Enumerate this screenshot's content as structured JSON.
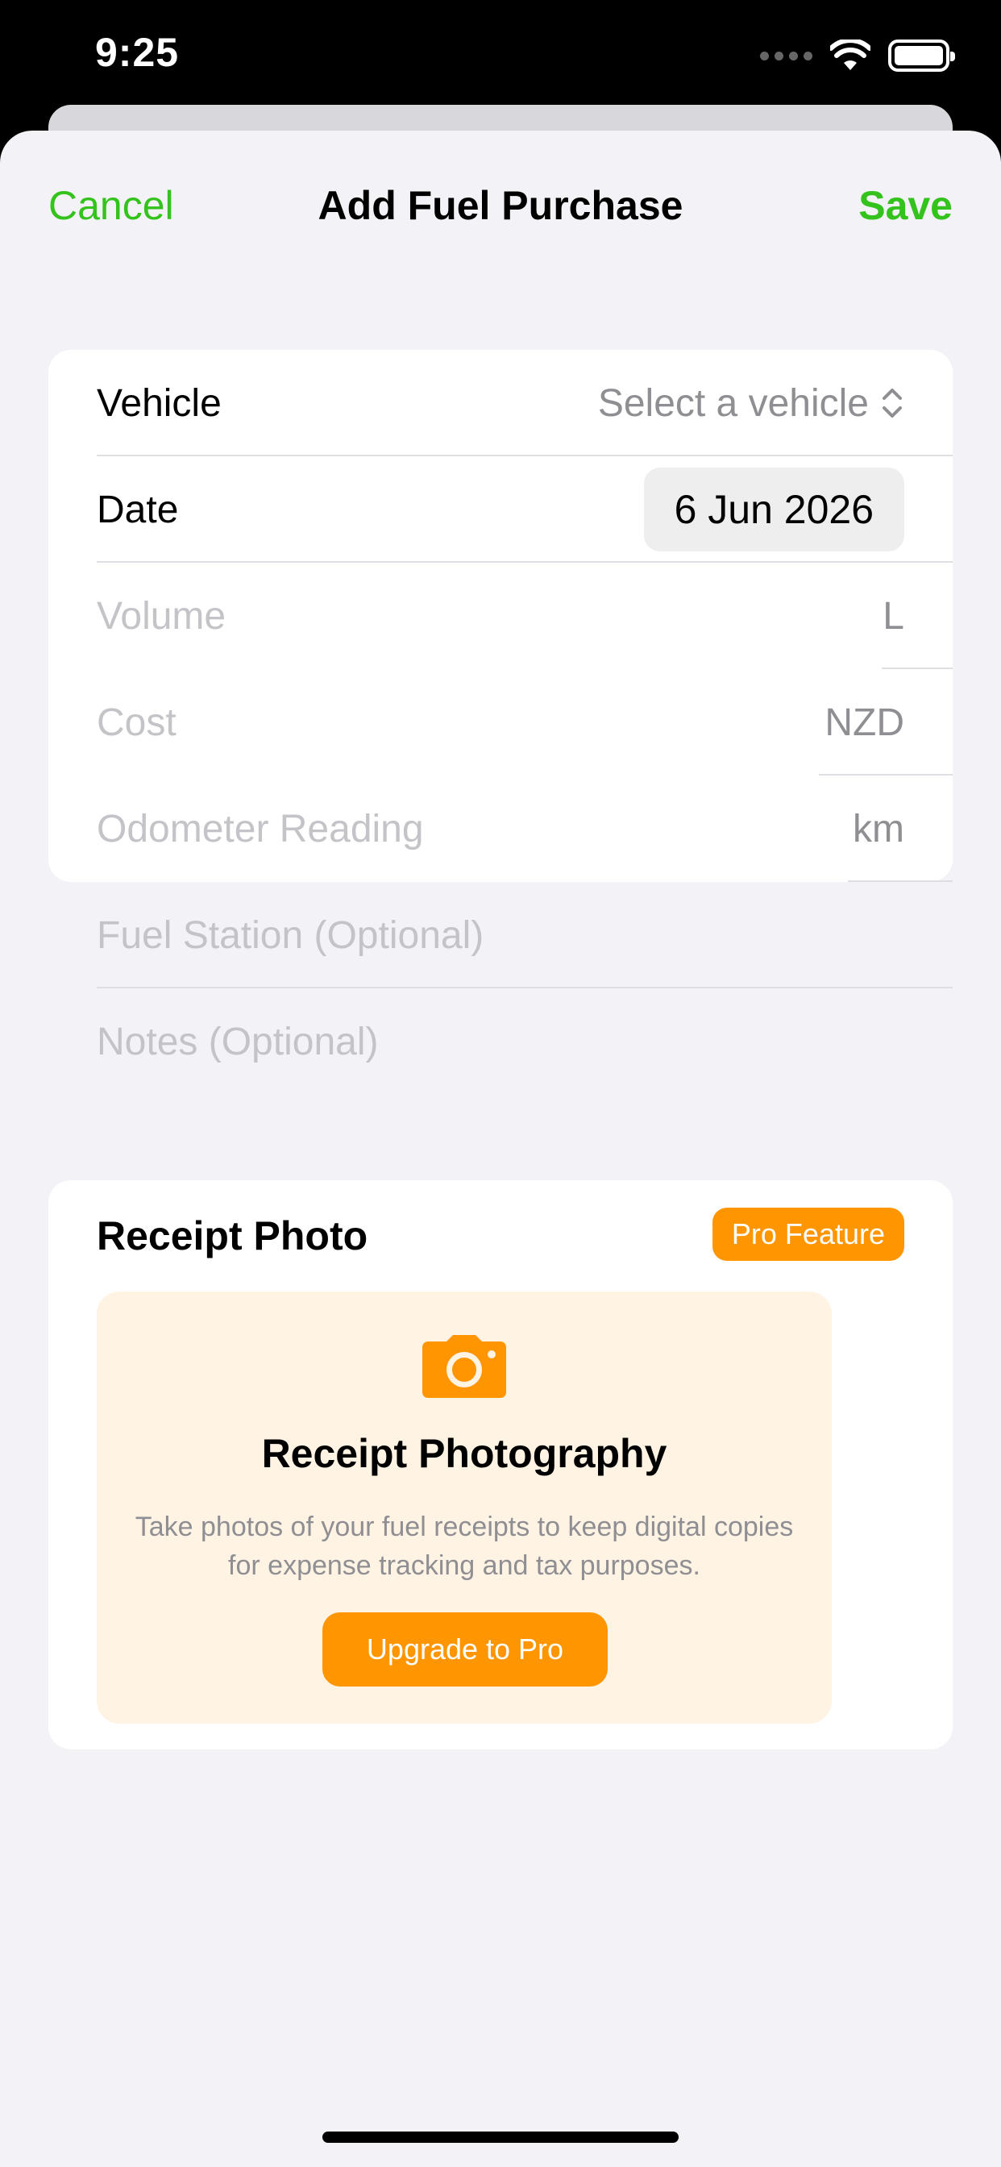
{
  "status": {
    "time": "9:25"
  },
  "nav": {
    "cancel_label": "Cancel",
    "title": "Add Fuel Purchase",
    "save_label": "Save"
  },
  "form": {
    "vehicle_label": "Vehicle",
    "vehicle_value": "Select a vehicle",
    "date_label": "Date",
    "date_value": "6 Jun 2026",
    "volume_placeholder": "Volume",
    "volume_unit": "L",
    "cost_placeholder": "Cost",
    "cost_unit": "NZD",
    "odometer_placeholder": "Odometer Reading",
    "odometer_unit": "km",
    "station_placeholder": "Fuel Station (Optional)",
    "notes_placeholder": "Notes (Optional)"
  },
  "receipt": {
    "title": "Receipt Photo",
    "badge": "Pro Feature",
    "promo_title": "Receipt Photography",
    "promo_description": "Take photos of your fuel receipts to keep digital copies for expense tracking and tax purposes.",
    "upgrade_label": "Upgrade to Pro"
  },
  "colors": {
    "accent_green": "#34c21c",
    "pro_orange": "#ff9500",
    "promo_background": "#fff3e4",
    "sheet_background": "#f2f2f7"
  },
  "icons": [
    "wifi-icon",
    "battery-icon",
    "chevron-up-down-icon",
    "camera-icon"
  ]
}
